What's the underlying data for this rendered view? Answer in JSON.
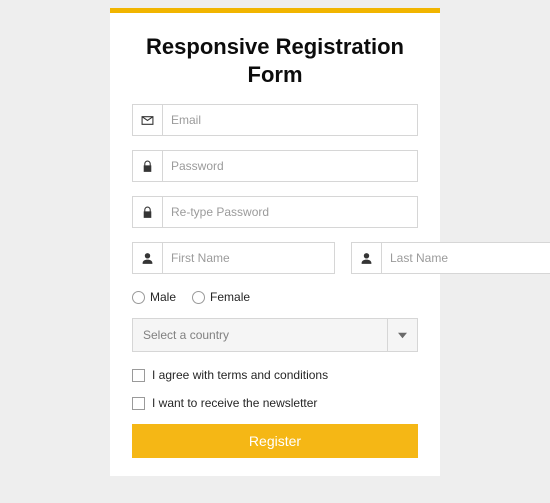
{
  "title": "Responsive Registration Form",
  "fields": {
    "email": {
      "placeholder": "Email"
    },
    "password": {
      "placeholder": "Password"
    },
    "repassword": {
      "placeholder": "Re-type Password"
    },
    "firstname": {
      "placeholder": "First Name"
    },
    "lastname": {
      "placeholder": "Last Name"
    }
  },
  "gender": {
    "male": "Male",
    "female": "Female"
  },
  "country": {
    "placeholder": "Select a country"
  },
  "terms": "I agree with terms and conditions",
  "newsletter": "I want to receive the newsletter",
  "submit": "Register"
}
